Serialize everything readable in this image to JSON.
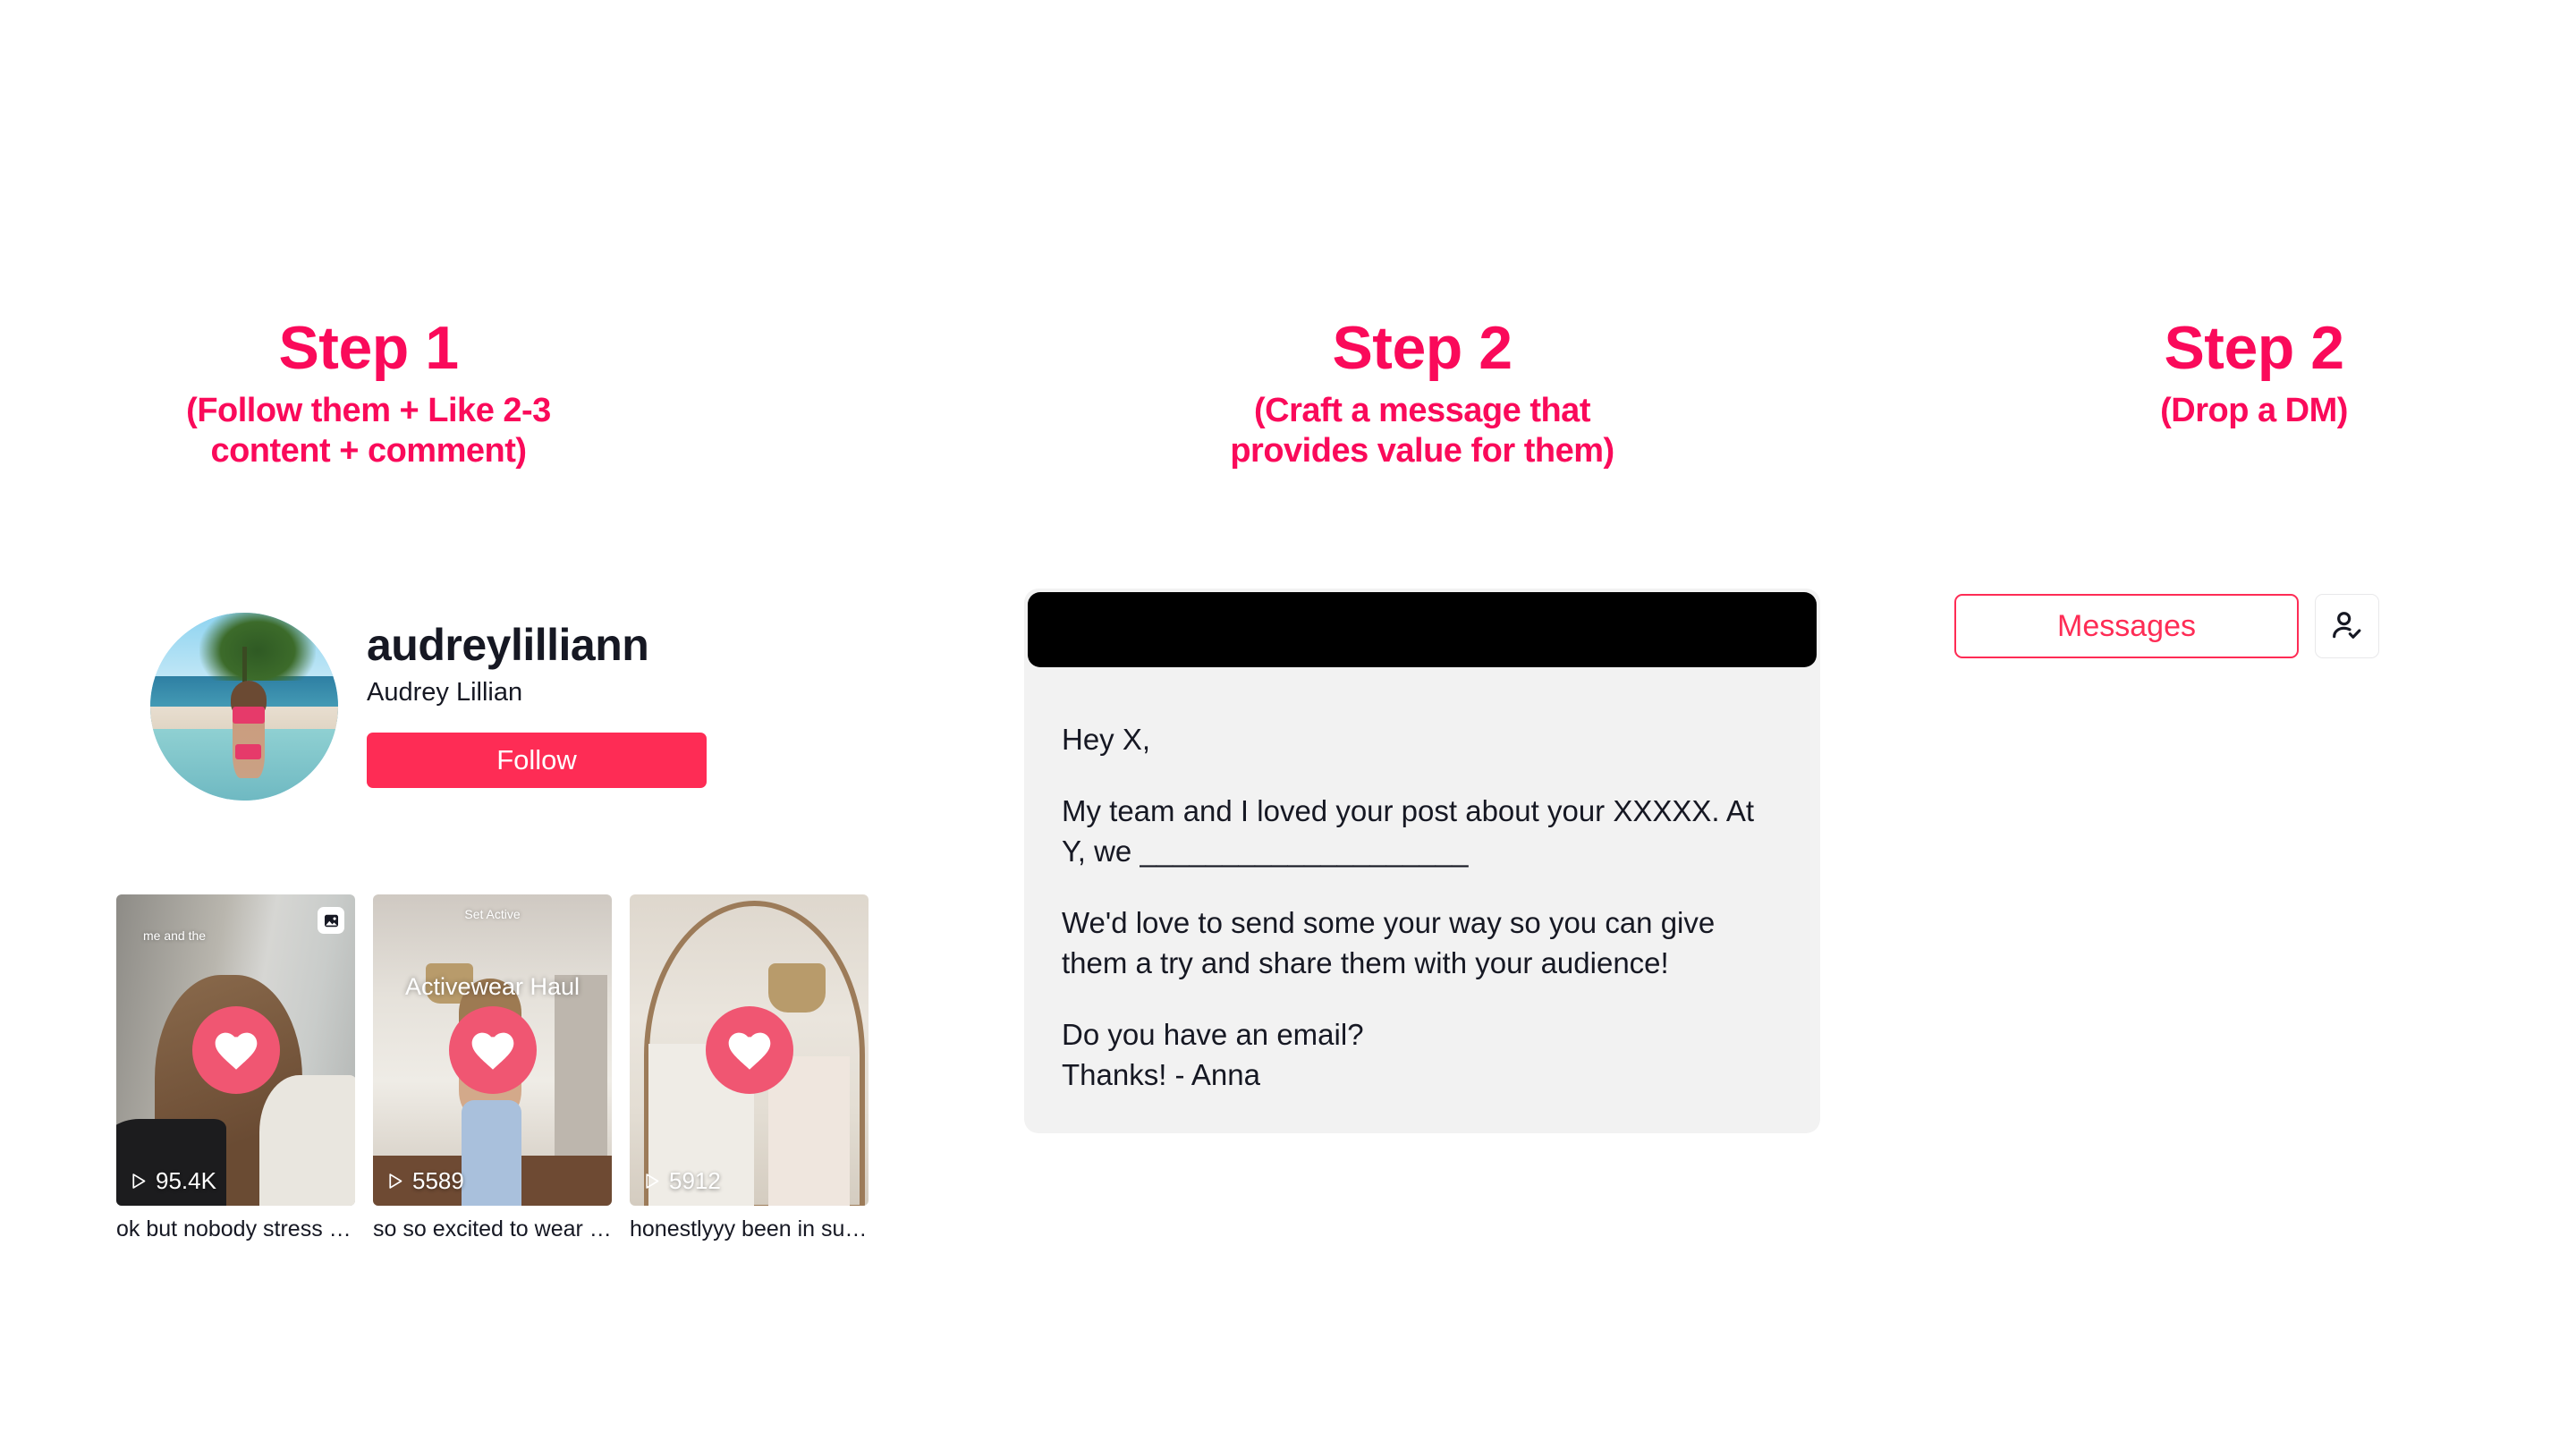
{
  "theme": {
    "accent_pink": "#FA0A5A",
    "tiktok_red": "#FE2C55",
    "heart_badge": "#F05672",
    "card_bg": "#F2F2F2",
    "text_dark": "#161823"
  },
  "columns": [
    {
      "id": "step-1",
      "title": "Step 1",
      "subtitle": "(Follow them + Like 2-3\ncontent + comment)"
    },
    {
      "id": "step-2-message",
      "title": "Step 2",
      "subtitle": "(Craft a message that\nprovides value for them)"
    },
    {
      "id": "step-2-dm",
      "title": "Step 2",
      "subtitle": "(Drop a DM)"
    }
  ],
  "profile": {
    "username": "audreylilliann",
    "display_name": "Audrey Lillian",
    "follow_button": "Follow",
    "avatar_alt": "beach-profile-photo"
  },
  "videos": [
    {
      "overlay_small": "me and the",
      "overlay_top": "",
      "overlay_big": "",
      "views": "95.4K",
      "caption": "ok but nobody stress …",
      "has_photo_badge": true,
      "liked": true
    },
    {
      "overlay_small": "",
      "overlay_top": "Set Active",
      "overlay_big": "Activewear Haul",
      "views": "5589",
      "caption": "so so excited to wear …",
      "has_photo_badge": false,
      "liked": true
    },
    {
      "overlay_small": "",
      "overlay_top": "",
      "overlay_big": "",
      "views": "5912",
      "caption": "honestlyyy been in su…",
      "has_photo_badge": false,
      "liked": true
    }
  ],
  "message": {
    "paragraphs": [
      "Hey X,",
      "My team and I loved your post about your XXXXX. At Y, we ____________________",
      "We'd love to send some your way so you can give them a try and share them with your audience!",
      "Do you have an email?\nThanks! - Anna"
    ]
  },
  "dm": {
    "messages_button": "Messages",
    "usercheck_icon": "user-check-icon"
  },
  "icons": {
    "heart": "heart-icon",
    "play": "play-icon",
    "photo": "photo-carousel-icon"
  }
}
